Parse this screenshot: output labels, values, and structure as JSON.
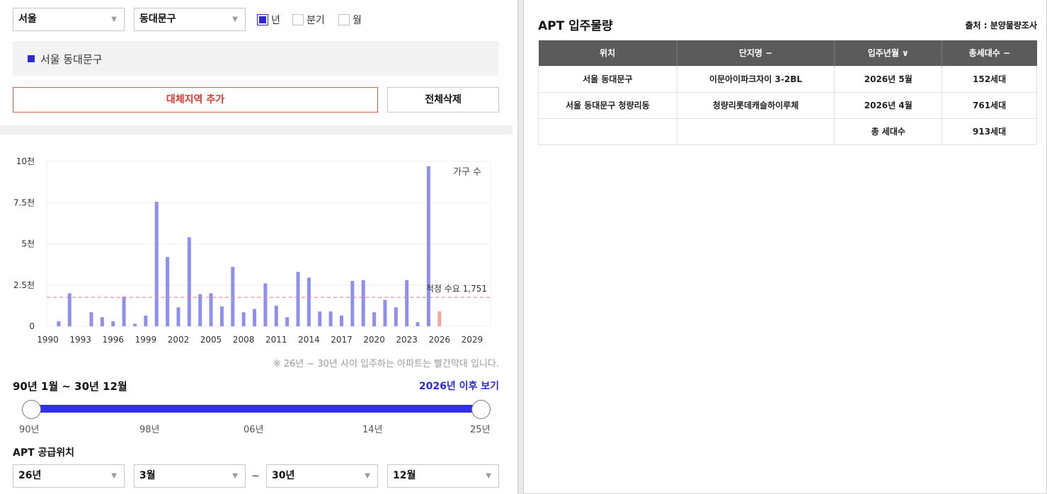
{
  "filters": {
    "city": "서울",
    "district": "동대문구",
    "period_options": [
      {
        "label": "년",
        "checked": true
      },
      {
        "label": "분기",
        "checked": false
      },
      {
        "label": "월",
        "checked": false
      }
    ],
    "arrow": "▼"
  },
  "region": {
    "label": "서울 동대문구"
  },
  "buttons": {
    "add_region": "대체지역 추가",
    "delete_all": "전체삭제"
  },
  "chart_data": {
    "type": "bar",
    "legend_label": "가구 수",
    "y_ticks": [
      "10천",
      "7.5천",
      "5천",
      "2.5천",
      "0"
    ],
    "ylim": [
      0,
      10000
    ],
    "x_ticks": [
      "1990",
      "1993",
      "1996",
      "1999",
      "2002",
      "2005",
      "2008",
      "2011",
      "2014",
      "2017",
      "2020",
      "2023",
      "2026",
      "2029"
    ],
    "xlim": [
      1989.9,
      2030.7
    ],
    "reference_line": {
      "label": "적정 수요 1,751",
      "value": 1751
    },
    "series": [
      {
        "color": "#8f8ff0",
        "points": [
          {
            "x": 1991,
            "y": 300
          },
          {
            "x": 1992,
            "y": 2000
          },
          {
            "x": 1994,
            "y": 850
          },
          {
            "x": 1995,
            "y": 550
          },
          {
            "x": 1996,
            "y": 300
          },
          {
            "x": 1997,
            "y": 1800
          },
          {
            "x": 1998,
            "y": 150
          },
          {
            "x": 1999,
            "y": 650
          },
          {
            "x": 2000,
            "y": 7550
          },
          {
            "x": 2001,
            "y": 4200
          },
          {
            "x": 2002,
            "y": 1150
          },
          {
            "x": 2003,
            "y": 5400
          },
          {
            "x": 2004,
            "y": 1950
          },
          {
            "x": 2005,
            "y": 2000
          },
          {
            "x": 2006,
            "y": 1200
          },
          {
            "x": 2007,
            "y": 3600
          },
          {
            "x": 2008,
            "y": 850
          },
          {
            "x": 2009,
            "y": 1050
          },
          {
            "x": 2010,
            "y": 2600
          },
          {
            "x": 2011,
            "y": 1250
          },
          {
            "x": 2012,
            "y": 550
          },
          {
            "x": 2013,
            "y": 3300
          },
          {
            "x": 2014,
            "y": 2950
          },
          {
            "x": 2015,
            "y": 900
          },
          {
            "x": 2016,
            "y": 900
          },
          {
            "x": 2017,
            "y": 650
          },
          {
            "x": 2018,
            "y": 2750
          },
          {
            "x": 2019,
            "y": 2800
          },
          {
            "x": 2020,
            "y": 850
          },
          {
            "x": 2021,
            "y": 1600
          },
          {
            "x": 2022,
            "y": 1150
          },
          {
            "x": 2023,
            "y": 2800
          },
          {
            "x": 2024,
            "y": 250
          },
          {
            "x": 2025,
            "y": 9700
          }
        ]
      },
      {
        "color": "#f4a89a",
        "points": [
          {
            "x": 2026,
            "y": 913
          }
        ]
      }
    ]
  },
  "note": "※ 26년 ~ 30년 사이 입주하는 아파트는 빨간막대 입니다.",
  "range": {
    "title": "90년 1월 ~ 30년 12월",
    "link": "2026년 이후 보기",
    "tick_labels": [
      "90년",
      "98년",
      "06년",
      "14년",
      "25년"
    ]
  },
  "supply": {
    "title": "APT 공급위치",
    "from_year": "26년",
    "from_month": "3월",
    "tilde": "~",
    "to_year": "30년",
    "to_month": "12월"
  },
  "right": {
    "title": "APT 입주물량",
    "source": "출처 : 분양물량조사",
    "headers": [
      "위치",
      "단지명 −",
      "입주년월 ∨",
      "총세대수 −"
    ],
    "rows": [
      [
        "서울 동대문구",
        "이문아이파크자이 3-2BL",
        "2026년 5월",
        "152세대"
      ],
      [
        "서울 동대문구 청량리동",
        "청량리롯데캐슬하이루체",
        "2026년 4월",
        "761세대"
      ],
      [
        "",
        "",
        "총 세대수",
        "913세대"
      ]
    ]
  }
}
